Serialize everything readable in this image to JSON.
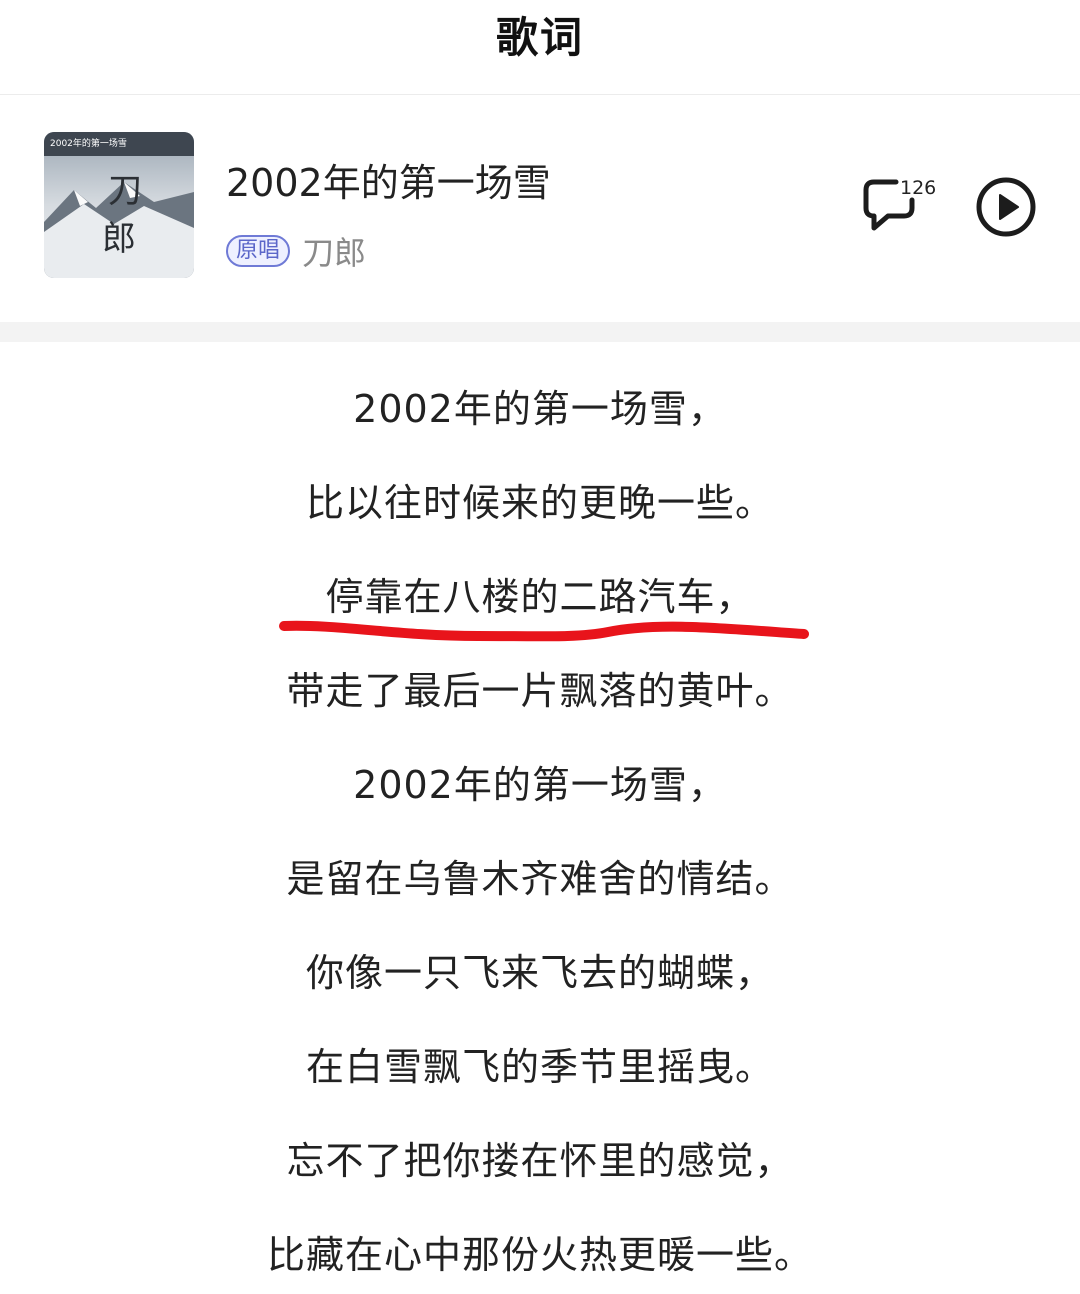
{
  "header": {
    "title": "歌词"
  },
  "song": {
    "title": "2002年的第一场雪",
    "badge": "原唱",
    "artist": "刀郎",
    "comment_count": "126",
    "cover": {
      "top_text": "2002年的第一场雪",
      "char1": "刀",
      "char2": "郎"
    }
  },
  "lyrics": [
    "2002年的第一场雪，",
    "比以往时候来的更晚一些。",
    "停靠在八楼的二路汽车，",
    "带走了最后一片飘落的黄叶。",
    "2002年的第一场雪，",
    "是留在乌鲁木齐难舍的情结。",
    "你像一只飞来飞去的蝴蝶，",
    "在白雪飘飞的季节里摇曳。",
    "忘不了把你搂在怀里的感觉，",
    "比藏在心中那份火热更暖一些。"
  ],
  "annotation_color": "#e8141b"
}
